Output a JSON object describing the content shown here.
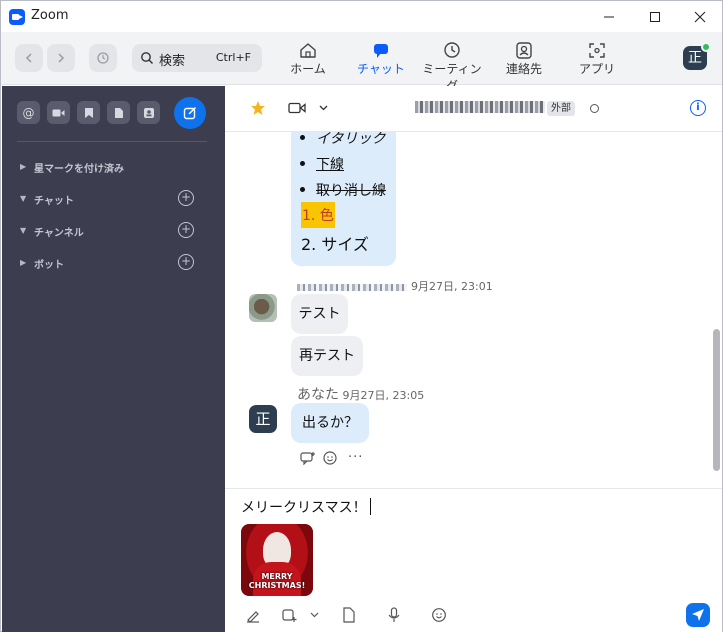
{
  "window": {
    "title": "Zoom",
    "minimize_icon": "minimize-icon",
    "maximize_icon": "maximize-icon",
    "close_icon": "close-icon"
  },
  "toolbar": {
    "search_placeholder": "検索",
    "search_shortcut": "Ctrl+F",
    "tabs": [
      {
        "label": "ホーム",
        "icon": "home-icon"
      },
      {
        "label": "チャット",
        "icon": "chat-icon",
        "active": true
      },
      {
        "label": "ミーティング",
        "icon": "clock-icon"
      },
      {
        "label": "連絡先",
        "icon": "contacts-icon"
      },
      {
        "label": "アプリ",
        "icon": "apps-icon"
      }
    ],
    "avatar_initial": "正",
    "accent": "#0b5cff"
  },
  "sidebar": {
    "sections": [
      {
        "label": "星マークを付け済み",
        "expanded": false,
        "add": false
      },
      {
        "label": "チャット",
        "expanded": true,
        "add": true
      },
      {
        "label": "チャンネル",
        "expanded": true,
        "add": true
      },
      {
        "label": "ボット",
        "expanded": false,
        "add": true
      }
    ],
    "bg": "#3c3d4f"
  },
  "chat_header": {
    "external_badge": "外部"
  },
  "messages": {
    "list_items": [
      "イタリック",
      "下線",
      "取り消し線"
    ],
    "ordered_items": [
      "1. 色",
      "2. サイズ"
    ],
    "their_time": "9月27日, 23:01",
    "their_msgs": [
      "テスト",
      "再テスト"
    ],
    "my_name": "あなた",
    "my_time": "9月27日, 23:05",
    "my_msg": "出るか？",
    "my_avatar": "正"
  },
  "composer": {
    "draft": "メリークリスマス！",
    "sticker_text_1": "MERRY",
    "sticker_text_2": "CHRISTMAS!"
  }
}
